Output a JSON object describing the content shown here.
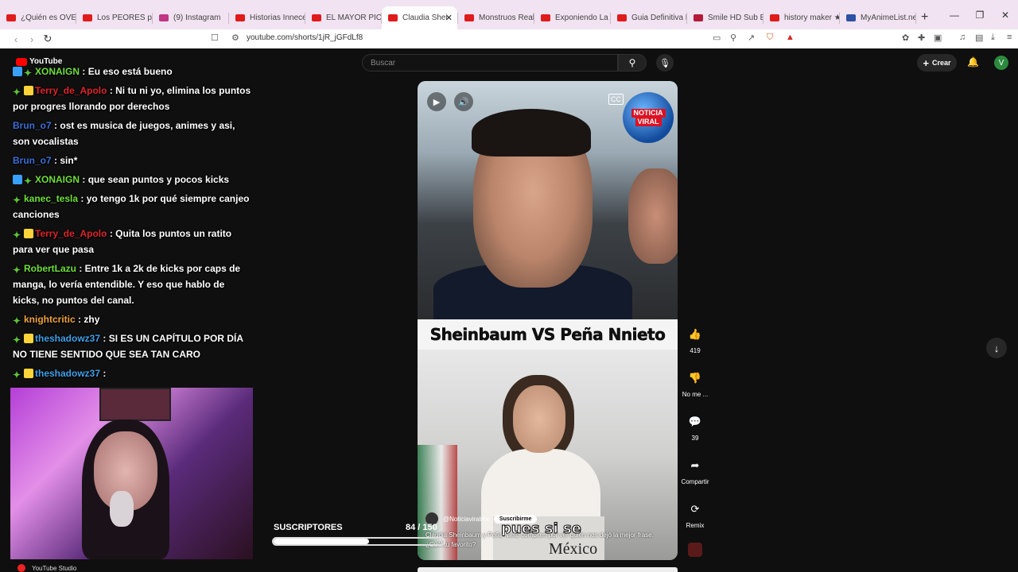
{
  "browser": {
    "tabs": [
      {
        "label": "¿Quién es OVEJA",
        "color": "#e01b1b"
      },
      {
        "label": "Los PEORES plot",
        "color": "#e01b1b"
      },
      {
        "label": "(9) Instagram",
        "color": "#c13584"
      },
      {
        "label": "Historias Innece",
        "color": "#e01b1b"
      },
      {
        "label": "EL MAYOR PICK",
        "color": "#e01b1b"
      },
      {
        "label": "Claudia Shei",
        "color": "#e01b1b",
        "active": true
      },
      {
        "label": "Monstruos Reale",
        "color": "#e01b1b"
      },
      {
        "label": "Exponiendo La G",
        "color": "#e01b1b"
      },
      {
        "label": "Guia Definitiva P",
        "color": "#e01b1b"
      },
      {
        "label": "Smile HD Sub Esp",
        "color": "#b5193a"
      },
      {
        "label": "history maker ★",
        "color": "#e01b1b"
      },
      {
        "label": "MyAnimeList.net",
        "color": "#2e51a2"
      }
    ],
    "url": "youtube.com/shorts/1jR_jGFdLf8"
  },
  "header": {
    "search_placeholder": "Buscar",
    "create_label": "Crear",
    "avatar_letter": "V",
    "logo": "YouTube",
    "logo_region": "UY"
  },
  "chat": [
    {
      "user": "XONAIGN",
      "color": "#6fe03a",
      "badges": [
        "mod",
        "star"
      ],
      "text": ": Eu eso está bueno"
    },
    {
      "user": "Terry_de_Apolo",
      "color": "#e0242b",
      "badges": [
        "star",
        "box"
      ],
      "text": ": Ni tu ni yo, elimina los puntos por progres llorando por derechos"
    },
    {
      "user": "Brun_o7",
      "color": "#3a6fd8",
      "badges": [],
      "text": ": ost es musica de juegos, animes y asi, son vocalistas"
    },
    {
      "user": "Brun_o7",
      "color": "#3a6fd8",
      "badges": [],
      "text": ": sin*"
    },
    {
      "user": "XONAIGN",
      "color": "#6fe03a",
      "badges": [
        "mod",
        "star"
      ],
      "text": ": que sean puntos y pocos kicks"
    },
    {
      "user": "kanec_tesla",
      "color": "#6fe03a",
      "badges": [
        "star"
      ],
      "text": ": yo tengo 1k por qué siempre canjeo canciones"
    },
    {
      "user": "Terry_de_Apolo",
      "color": "#e0242b",
      "badges": [
        "star",
        "box"
      ],
      "text": ": Quita los puntos un ratito para ver que pasa"
    },
    {
      "user": "RobertLazu",
      "color": "#6fe03a",
      "badges": [
        "star"
      ],
      "text": ": Entre 1k a 2k de kicks por caps de manga, lo vería entendible. Y eso que hablo de kicks, no puntos del canal."
    },
    {
      "user": "knightcritic",
      "color": "#f2a43a",
      "badges": [
        "star"
      ],
      "text": ": zhy"
    },
    {
      "user": "theshadowz37",
      "color": "#3fa0e8",
      "badges": [
        "star",
        "box"
      ],
      "text": ": SI ES UN CAPÍTULO POR DÍA NO TIENE SENTIDO QUE SEA TAN CARO"
    },
    {
      "user": "theshadowz37",
      "color": "#3fa0e8",
      "badges": [
        "star",
        "box"
      ],
      "text": ":"
    }
  ],
  "video": {
    "title_overlay": "Sheinbaum VS Peña Nnieto",
    "caption_word": "pues si se",
    "backdrop_text": "México",
    "badge_line1": "NOTICIA",
    "badge_line2": "VIRAL",
    "channel": "@Noticiaviralmx",
    "subscribe": "Suscribirme",
    "description": "Claudia Sheinbaum y Peña Nieto compiten por ver quién nos dejó la mejor frase. ¿Cuál tu favorito?"
  },
  "actions": {
    "likes": "419",
    "dislike": "No me ...",
    "comments": "39",
    "share": "Compartir",
    "remix": "Remix"
  },
  "overlay": {
    "subs_label": "SUSCRIPTORES",
    "subs_count": "84 / 150",
    "subs_progress": 0.56,
    "studio": "YouTube Studio"
  }
}
